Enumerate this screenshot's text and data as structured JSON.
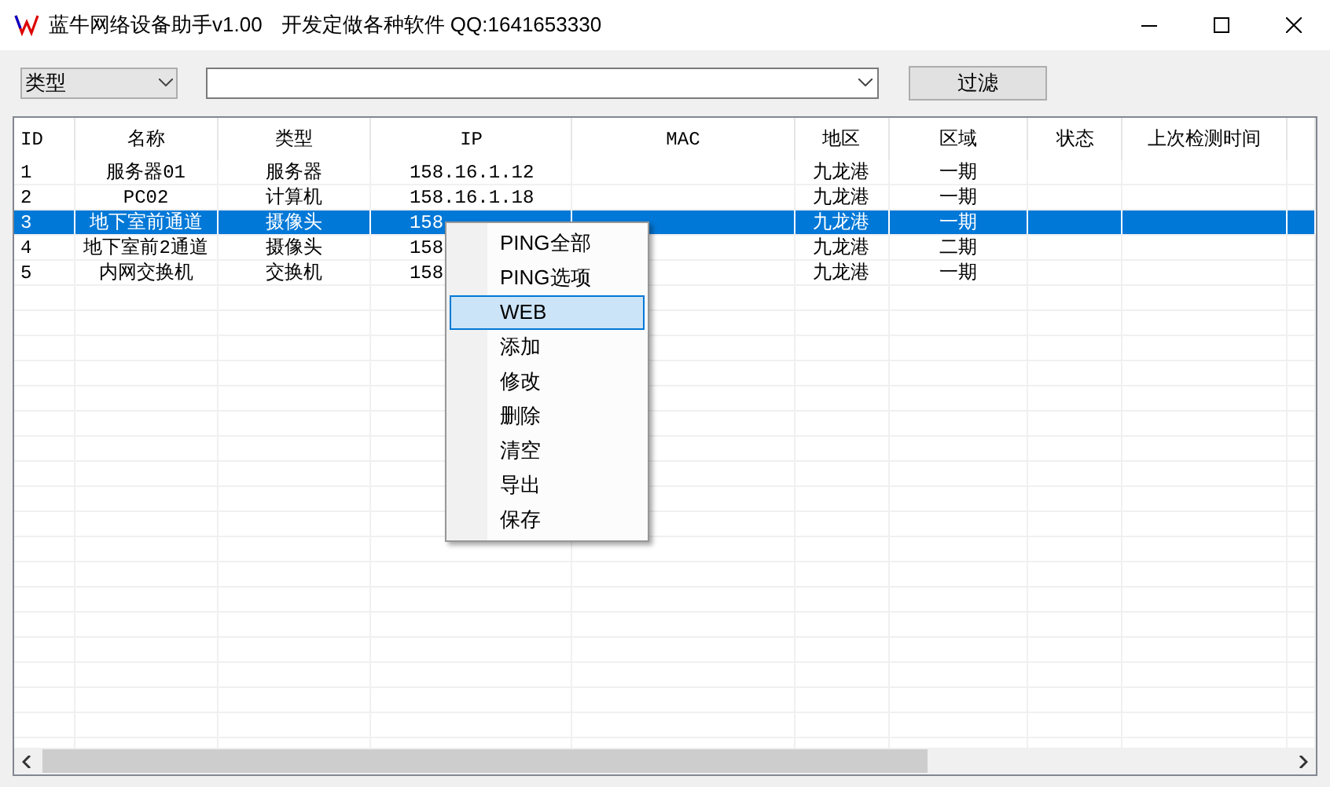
{
  "window": {
    "title": "蓝牛网络设备助手v1.00",
    "subtitle": "开发定做各种软件 QQ:1641653330"
  },
  "toolbar": {
    "type_select": "类型",
    "filter_button": "过滤"
  },
  "table": {
    "columns": [
      "ID",
      "名称",
      "类型",
      "IP",
      "MAC",
      "地区",
      "区域",
      "状态",
      "上次检测时间"
    ],
    "rows": [
      {
        "cells": [
          "1",
          "服务器01",
          "服务器",
          "158.16.1.12",
          "",
          "九龙港",
          "一期",
          "",
          ""
        ],
        "selected": false
      },
      {
        "cells": [
          "2",
          "PC02",
          "计算机",
          "158.16.1.18",
          "",
          "九龙港",
          "一期",
          "",
          ""
        ],
        "selected": false
      },
      {
        "cells": [
          "3",
          "地下室前通道",
          "摄像头",
          "158",
          "",
          "九龙港",
          "一期",
          "",
          ""
        ],
        "selected": true
      },
      {
        "cells": [
          "4",
          "地下室前2通道",
          "摄像头",
          "158",
          "",
          "九龙港",
          "二期",
          "",
          ""
        ],
        "selected": false
      },
      {
        "cells": [
          "5",
          "内网交换机",
          "交换机",
          "158",
          "",
          "九龙港",
          "一期",
          "",
          ""
        ],
        "selected": false
      }
    ]
  },
  "context_menu": {
    "items": [
      {
        "label": "PING全部",
        "selected": false
      },
      {
        "label": "PING选项",
        "selected": false
      },
      {
        "label": "WEB",
        "selected": true
      },
      {
        "label": "添加",
        "selected": false
      },
      {
        "label": "修改",
        "selected": false
      },
      {
        "label": "删除",
        "selected": false
      },
      {
        "label": "清空",
        "selected": false
      },
      {
        "label": "导出",
        "selected": false
      },
      {
        "label": "保存",
        "selected": false
      }
    ]
  }
}
